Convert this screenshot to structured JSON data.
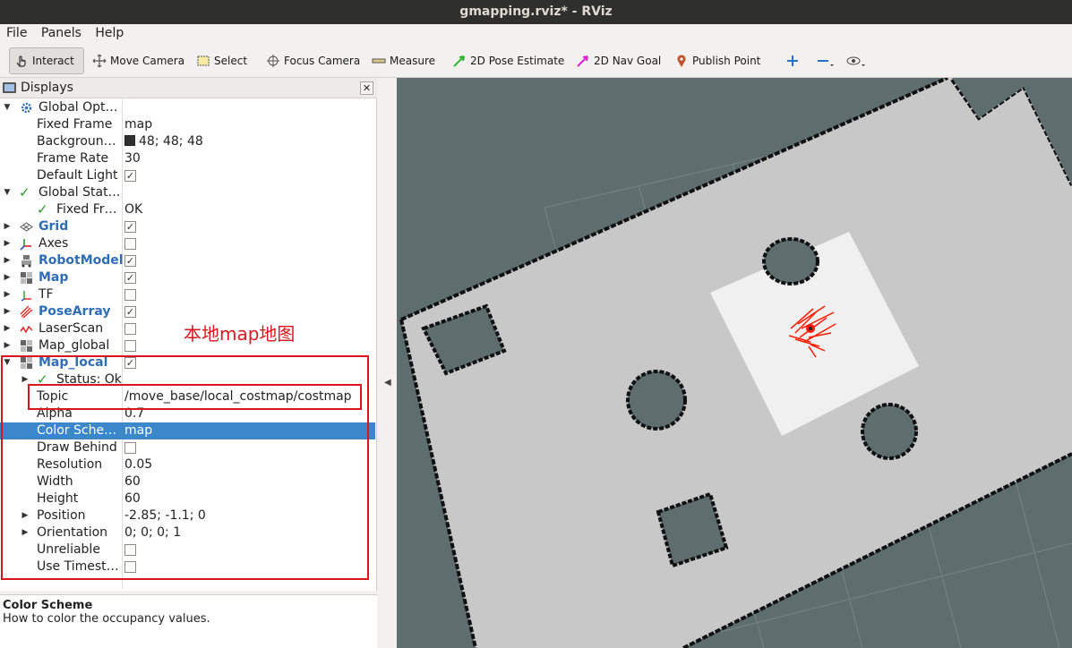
{
  "window": {
    "title": "gmapping.rviz* - RViz"
  },
  "menu": [
    "File",
    "Panels",
    "Help"
  ],
  "toolbar": {
    "tools": [
      {
        "label": "Interact",
        "icon": "hand-pointer-icon",
        "active": true
      },
      {
        "label": "Move Camera",
        "icon": "move-camera-icon"
      },
      {
        "label": "Select",
        "icon": "select-box-icon"
      },
      {
        "label": "Focus Camera",
        "icon": "focus-crosshair-icon"
      },
      {
        "label": "Measure",
        "icon": "ruler-icon"
      },
      {
        "label": "2D Pose Estimate",
        "icon": "green-arrow-icon"
      },
      {
        "label": "2D Nav Goal",
        "icon": "magenta-arrow-icon"
      },
      {
        "label": "Publish Point",
        "icon": "map-pin-icon"
      }
    ]
  },
  "displays_panel": {
    "title": "Displays",
    "rows": [
      {
        "label": "Global Opt…",
        "value": ""
      },
      {
        "label": "Fixed Frame",
        "value": "map"
      },
      {
        "label": "Backgroun…",
        "value": "48; 48; 48"
      },
      {
        "label": "Frame Rate",
        "value": "30"
      },
      {
        "label": "Default Light",
        "value": ""
      },
      {
        "label": "Global Stat…",
        "value": ""
      },
      {
        "label": "Fixed Fr…",
        "value": "OK"
      },
      {
        "label": "Grid",
        "value": ""
      },
      {
        "label": "Axes",
        "value": ""
      },
      {
        "label": "RobotModel",
        "value": ""
      },
      {
        "label": "Map",
        "value": ""
      },
      {
        "label": "TF",
        "value": ""
      },
      {
        "label": "PoseArray",
        "value": ""
      },
      {
        "label": "LaserScan",
        "value": ""
      },
      {
        "label": "Map_global",
        "value": ""
      },
      {
        "label": "Map_local",
        "value": ""
      },
      {
        "label": "Status: Ok",
        "value": ""
      },
      {
        "label": "Topic",
        "value": "/move_base/local_costmap/costmap"
      },
      {
        "label": "Alpha",
        "value": "0.7"
      },
      {
        "label": "Color Sche…",
        "value": "map"
      },
      {
        "label": "Draw Behind",
        "value": ""
      },
      {
        "label": "Resolution",
        "value": "0.05"
      },
      {
        "label": "Width",
        "value": "60"
      },
      {
        "label": "Height",
        "value": "60"
      },
      {
        "label": "Position",
        "value": "-2.85; -1.1; 0"
      },
      {
        "label": "Orientation",
        "value": "0; 0; 0; 1"
      },
      {
        "label": "Unreliable",
        "value": ""
      },
      {
        "label": "Use Timest…",
        "value": ""
      }
    ]
  },
  "annotation": "本地map地图",
  "description": {
    "title": "Color Scheme",
    "text": "How to color the occupancy values."
  },
  "colors": {
    "highlight": "#3a87c9",
    "annotation": "#d9161d",
    "viewport_bg": "#5e6e6e",
    "map_free": "#c8c8c8",
    "local_costmap": "#f0f0f0"
  }
}
